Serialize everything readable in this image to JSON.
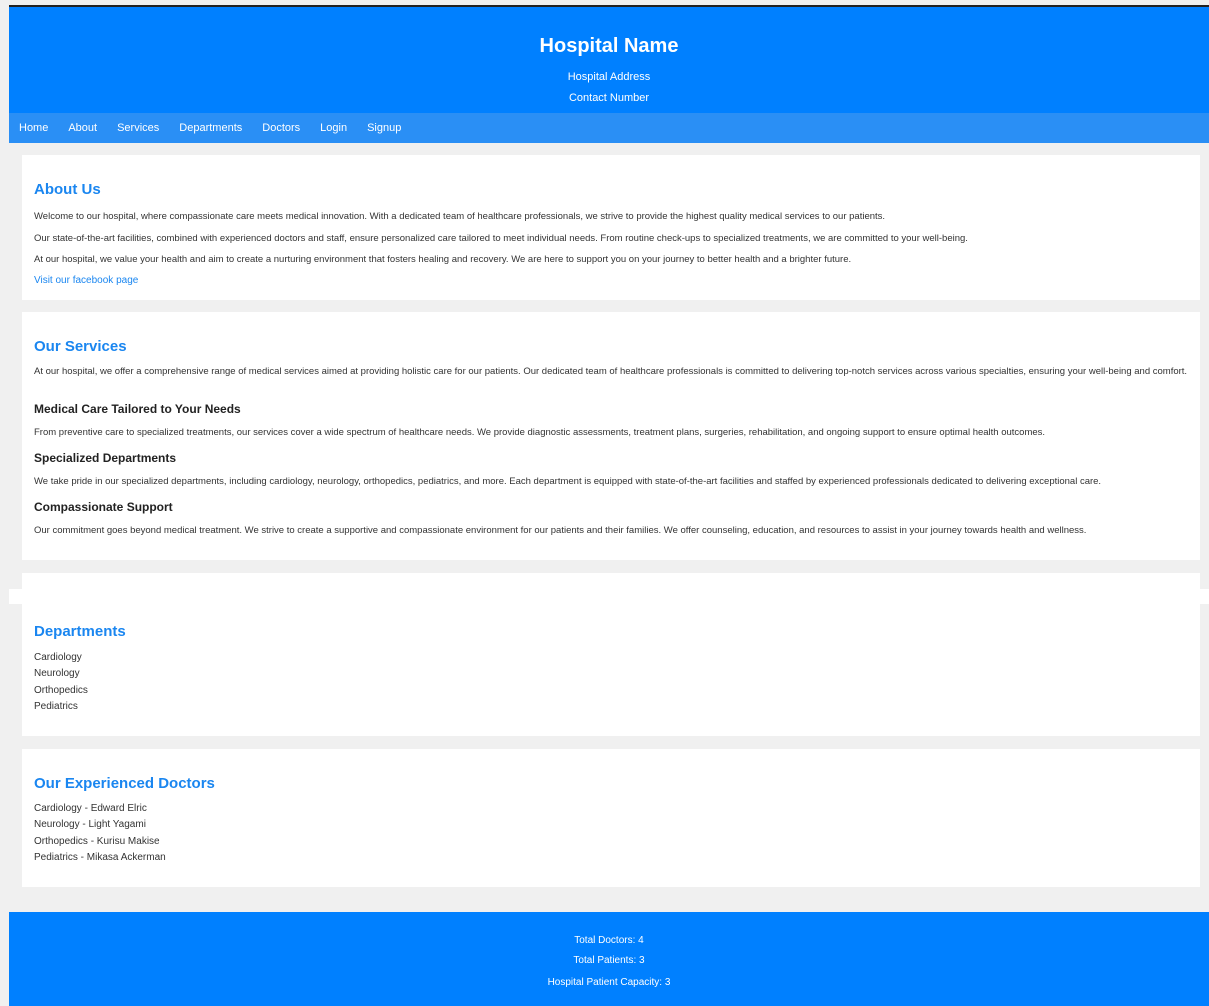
{
  "header": {
    "title": "Hospital Name",
    "address": "Hospital Address",
    "contact": "Contact Number"
  },
  "nav": [
    "Home",
    "About",
    "Services",
    "Departments",
    "Doctors",
    "Login",
    "Signup"
  ],
  "about": {
    "heading": "About Us",
    "paragraphs": [
      "Welcome to our hospital, where compassionate care meets medical innovation. With a dedicated team of healthcare professionals, we strive to provide the highest quality medical services to our patients.",
      "Our state-of-the-art facilities, combined with experienced doctors and staff, ensure personalized care tailored to meet individual needs. From routine check-ups to specialized treatments, we are committed to your well-being.",
      "At our hospital, we value your health and aim to create a nurturing environment that fosters healing and recovery. We are here to support you on your journey to better health and a brighter future."
    ],
    "link": "Visit our facebook page"
  },
  "services": {
    "heading": "Our Services",
    "intro": "At our hospital, we offer a comprehensive range of medical services aimed at providing holistic care for our patients. Our dedicated team of healthcare professionals is committed to delivering top-notch services across various specialties, ensuring your well-being and comfort.",
    "items": [
      {
        "title": "Medical Care Tailored to Your Needs",
        "text": "From preventive care to specialized treatments, our services cover a wide spectrum of healthcare needs. We provide diagnostic assessments, treatment plans, surgeries, rehabilitation, and ongoing support to ensure optimal health outcomes."
      },
      {
        "title": "Specialized Departments",
        "text": "We take pride in our specialized departments, including cardiology, neurology, orthopedics, pediatrics, and more. Each department is equipped with state-of-the-art facilities and staffed by experienced professionals dedicated to delivering exceptional care."
      },
      {
        "title": "Compassionate Support",
        "text": "Our commitment goes beyond medical treatment. We strive to create a supportive and compassionate environment for our patients and their families. We offer counseling, education, and resources to assist in your journey towards health and wellness."
      }
    ]
  },
  "departments": {
    "heading": "Departments",
    "items": [
      "Cardiology",
      "Neurology",
      "Orthopedics",
      "Pediatrics"
    ]
  },
  "doctors": {
    "heading": "Our Experienced Doctors",
    "items": [
      "Cardiology - Edward Elric",
      "Neurology - Light Yagami",
      "Orthopedics - Kurisu Makise",
      "Pediatrics - Mikasa Ackerman"
    ]
  },
  "footer": {
    "total_doctors": "Total Doctors: 4",
    "total_patients": "Total Patients: 3",
    "capacity": "Hospital Patient Capacity: 3"
  },
  "colors": {
    "primary": "#0080ff",
    "nav": "#2a8ff5",
    "heading": "#1a86f0",
    "background": "#f0f0f0"
  }
}
